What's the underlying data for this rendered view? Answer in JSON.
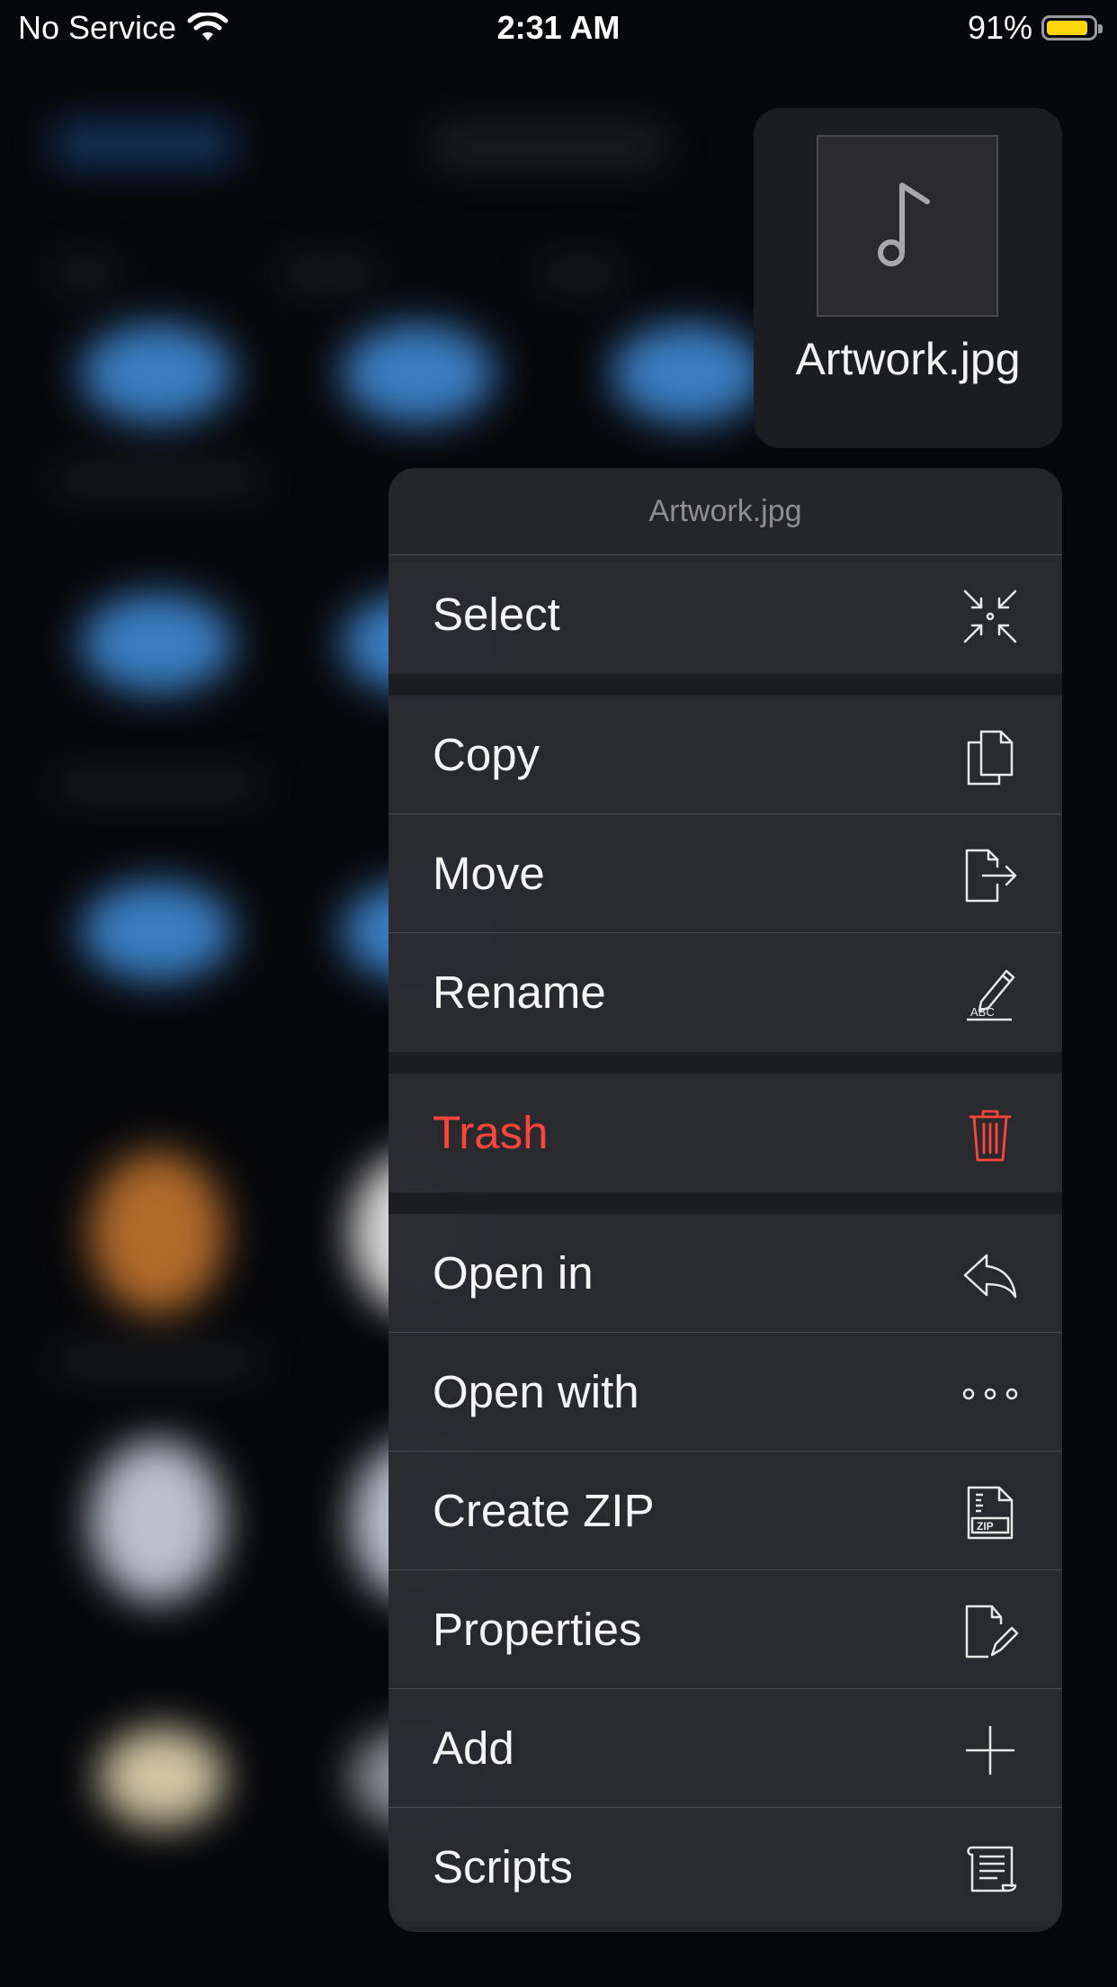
{
  "status_bar": {
    "carrier": "No Service",
    "time": "2:31 AM",
    "battery_percent": "91%",
    "battery_level": 0.91,
    "wifi_icon": "wifi-icon"
  },
  "preview": {
    "file_name": "Artwork.jpg",
    "icon": "music-note-icon"
  },
  "menu": {
    "title": "Artwork.jpg",
    "groups": [
      [
        {
          "label": "Select",
          "icon": "select-arrows-icon"
        }
      ],
      [
        {
          "label": "Copy",
          "icon": "copy-icon"
        },
        {
          "label": "Move",
          "icon": "move-icon"
        },
        {
          "label": "Rename",
          "icon": "rename-pencil-abc-icon"
        }
      ],
      [
        {
          "label": "Trash",
          "icon": "trash-icon",
          "destructive": true
        }
      ],
      [
        {
          "label": "Open in",
          "icon": "reply-arrow-icon"
        },
        {
          "label": "Open with",
          "icon": "ellipsis-icon"
        },
        {
          "label": "Create ZIP",
          "icon": "zip-file-icon"
        },
        {
          "label": "Properties",
          "icon": "document-edit-icon"
        },
        {
          "label": "Add",
          "icon": "plus-icon"
        },
        {
          "label": "Scripts",
          "icon": "scroll-icon"
        }
      ]
    ]
  },
  "colors": {
    "destructive": "#ff453a",
    "battery": "#ffd60a",
    "menu_bg": "#26272b"
  }
}
